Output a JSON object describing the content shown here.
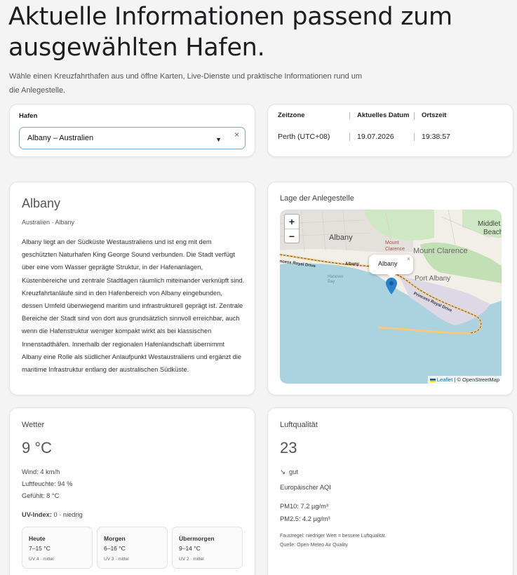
{
  "hero": {
    "title": "Aktuelle Informationen passend zum ausgewählten Hafen.",
    "subtitle": "Wähle einen Kreuzfahrthafen aus und öffne Karten, Live-Dienste und praktische Informationen rund um die Anlegestelle."
  },
  "port_select": {
    "label": "Hafen",
    "value": "Albany – Australien",
    "clear": "×",
    "arrow": "▼"
  },
  "time_info": {
    "timezone_label": "Zeitzone",
    "date_label": "Aktuelles Datum",
    "time_label": "Ortszeit",
    "sep": "|",
    "timezone": "Perth (UTC+08)",
    "date": "19.07.2026",
    "time": "19:38:57"
  },
  "city": {
    "name": "Albany",
    "breadcrumb": "Australien · Albany",
    "description": "Albany liegt an der Südküste Westaustraliens und ist eng mit dem geschützten Naturhafen King George Sound verbunden. Die Stadt verfügt über eine vom Wasser geprägte Struktur, in der Hafenanlagen, Küstenbereiche und zentrale Stadtlagen räumlich miteinander verknüpft sind. Kreuzfahrtanläufe sind in den Hafenbereich von Albany eingebunden, dessen Umfeld überwiegend maritim und infrastrukturell geprägt ist. Zentrale Bereiche der Stadt sind von dort aus grundsätzlich sinnvoll erreichbar, auch wenn die Hafenstruktur weniger kompakt wirkt als bei klassischen Innenstadthäfen. Innerhalb der regionalen Hafenlandschaft übernimmt Albany eine Rolle als südlicher Anlaufpunkt Westaustraliens und ergänzt die maritime Infrastruktur entlang der australischen Südküste."
  },
  "map": {
    "title": "Lage der Anlegestelle",
    "zoom_in": "+",
    "zoom_out": "−",
    "popup": "Albany",
    "popup_close": "×",
    "labels": {
      "albany": "Albany",
      "middleton": "Middlet",
      "beach": "Beach",
      "mount_clarence": "Mount Clarence",
      "mount_clarence_small": "Mount Clarence",
      "port_albany": "Port Albany",
      "princess_royal": "Princess Royal Drive",
      "princess_royal_left": "ncess Royal Drive",
      "albany_small": "Albany",
      "hanover": "Hanover Bay"
    },
    "attribution_leaflet": "Leaflet",
    "attribution_rest": " | © OpenStreetMap"
  },
  "weather": {
    "title": "Wetter",
    "temp": "9 °C",
    "wind": "Wind: 4 km/h",
    "humidity": "Luftfeuchte: 94 %",
    "feels": "Gefühlt: 8 °C",
    "uv_label": "UV-Index:",
    "uv_value": " 0 · niedrig",
    "forecast": [
      {
        "day": "Heute",
        "range": "7–15 °C",
        "uv": "UV 4 · mittel"
      },
      {
        "day": "Morgen",
        "range": "6–16 °C",
        "uv": "UV 3 · mittel"
      },
      {
        "day": "Übermorgen",
        "range": "9–14 °C",
        "uv": "UV 2 · mittel"
      }
    ]
  },
  "air": {
    "title": "Luftqualität",
    "value": "23",
    "trend": "↘",
    "rating": "gut",
    "index_name": "Europäischer AQI",
    "pm10": "PM10: 7.2 µg/m³",
    "pm25": "PM2.5: 4.2 µg/m³",
    "rule": "Faustregel: niedriger Wert = bessere Luftqualität.",
    "source": "Quelle: Open-Meteo Air Quality"
  },
  "colors": {
    "accent_border": "#7aa7d9",
    "map_water": "#aad3df",
    "map_land": "#f2efe9",
    "marker": "#2a81cb"
  }
}
